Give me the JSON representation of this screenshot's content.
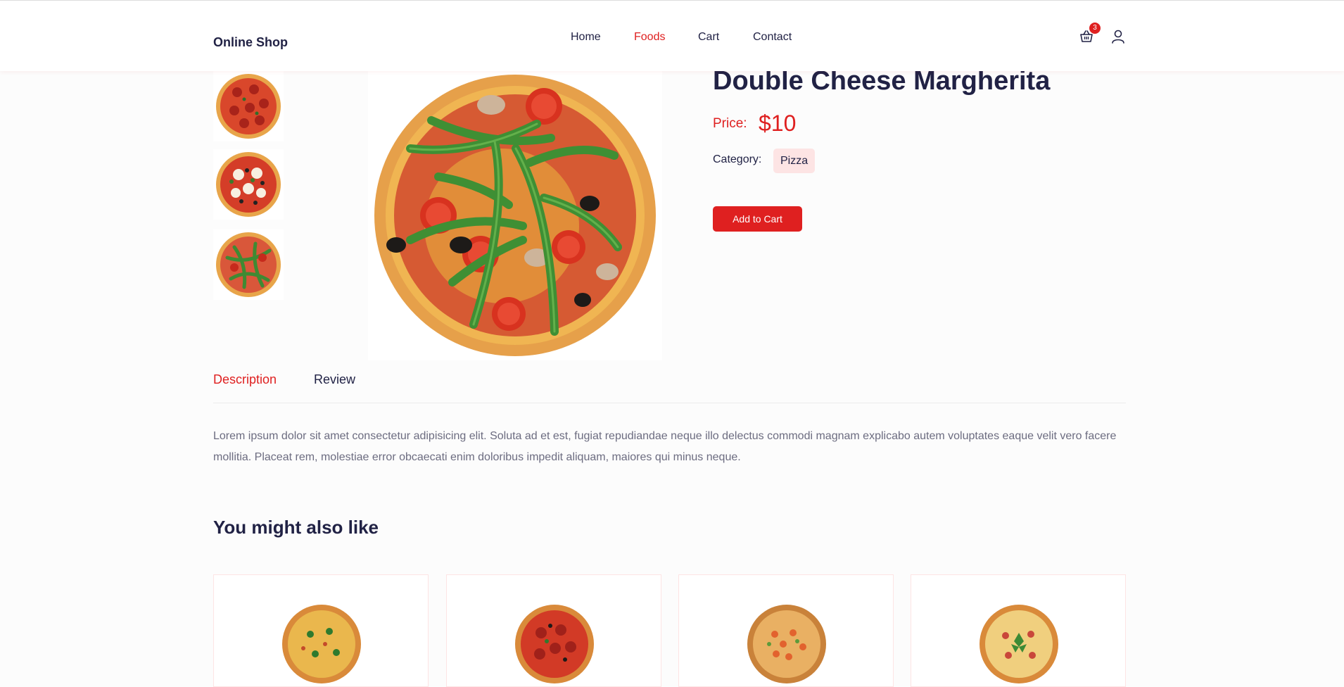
{
  "header": {
    "logo": "Online Shop",
    "nav": [
      {
        "label": "Home"
      },
      {
        "label": "Foods"
      },
      {
        "label": "Cart"
      },
      {
        "label": "Contact"
      }
    ],
    "active_nav": "Foods",
    "cart_count": "3",
    "icons": {
      "cart": "shopping-basket-icon",
      "user": "user-icon"
    }
  },
  "product": {
    "thumbnails": [
      {
        "name": "pepperoni-pizza"
      },
      {
        "name": "mozzarella-olive-pizza"
      },
      {
        "name": "arugula-pizza"
      }
    ],
    "main_image": "arugula-margherita-pizza",
    "title": "Double Cheese Margherita",
    "price_label": "Price:",
    "price": "$10",
    "category_label": "Category:",
    "category": "Pizza",
    "add_to_cart": "Add to Cart"
  },
  "tabs": {
    "items": [
      {
        "label": "Description"
      },
      {
        "label": "Review"
      }
    ],
    "active": "Description",
    "description": "Lorem ipsum dolor sit amet consectetur adipisicing elit. Soluta ad et est, fugiat repudiandae neque illo delectus commodi magnam explicabo autem voluptates eaque velit vero facere mollitia. Placeat rem, molestiae error obcaecati enim doloribus impedit aliquam, maiores qui minus neque."
  },
  "related": {
    "title": "You might also like",
    "items": [
      {
        "image": "cheese-basil-pizza"
      },
      {
        "image": "pepperoni-olive-pizza"
      },
      {
        "image": "seafood-pizza"
      },
      {
        "image": "ham-basil-pizza"
      }
    ]
  },
  "colors": {
    "accent": "#df2020",
    "text": "#212245",
    "muted": "#6c6c80",
    "badge_bg": "#fde4e4"
  }
}
